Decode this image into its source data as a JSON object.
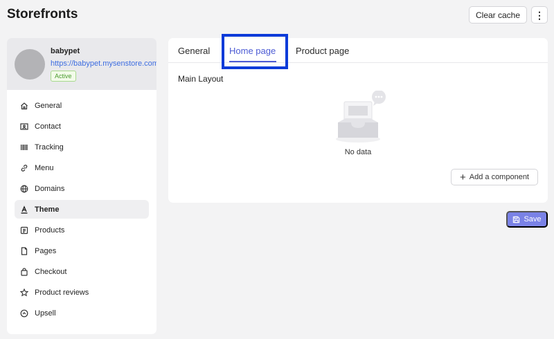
{
  "page": {
    "title": "Storefronts"
  },
  "top_actions": {
    "clear_cache": "Clear cache",
    "more": "⋮"
  },
  "store": {
    "name": "babypet",
    "url": "https://babypet.mysenstore.com",
    "status": "Active"
  },
  "sidebar": {
    "items": [
      {
        "label": "General",
        "icon": "home-icon"
      },
      {
        "label": "Contact",
        "icon": "contact-card-icon"
      },
      {
        "label": "Tracking",
        "icon": "barcode-icon"
      },
      {
        "label": "Menu",
        "icon": "link-icon"
      },
      {
        "label": "Domains",
        "icon": "globe-icon"
      },
      {
        "label": "Theme",
        "icon": "font-icon",
        "active": true
      },
      {
        "label": "Products",
        "icon": "product-icon"
      },
      {
        "label": "Pages",
        "icon": "page-icon"
      },
      {
        "label": "Checkout",
        "icon": "bag-icon"
      },
      {
        "label": "Product reviews",
        "icon": "star-icon"
      },
      {
        "label": "Upsell",
        "icon": "upsell-icon"
      }
    ]
  },
  "tabs": [
    {
      "label": "General"
    },
    {
      "label": "Home page",
      "active": true
    },
    {
      "label": "Product page"
    }
  ],
  "main": {
    "section_title": "Main Layout",
    "empty_text": "No data",
    "add_component": "Add a component"
  },
  "save_label": "Save",
  "colors": {
    "accent": "#4c5bd4",
    "save": "#7a82e6",
    "highlight": "#0b3bd9",
    "link": "#3d6de0"
  }
}
